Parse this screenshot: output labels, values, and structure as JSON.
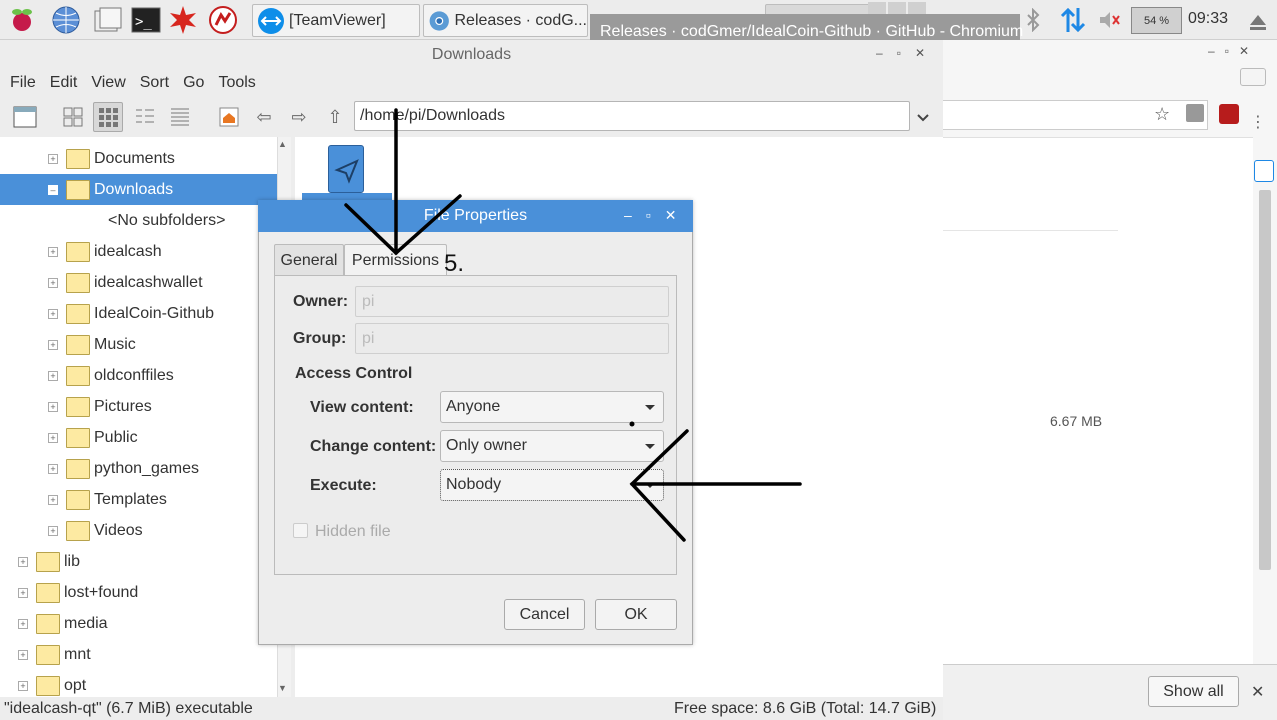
{
  "taskbar": {
    "tasks": [
      {
        "label": "[TeamViewer]"
      },
      {
        "label": "Releases · codG..."
      }
    ],
    "tooltip": "Releases · codGmer/IdealCoin-Github · GitHub - Chromium",
    "cpu": "54 %",
    "clock": "09:33"
  },
  "chromium": {
    "download_size": "6.67 MB",
    "show_all": "Show all"
  },
  "file_manager": {
    "title": "Downloads",
    "menu": [
      "File",
      "Edit",
      "View",
      "Sort",
      "Go",
      "Tools"
    ],
    "path": "/home/pi/Downloads",
    "tree": [
      {
        "label": "Documents",
        "indent": 1,
        "expander": "+"
      },
      {
        "label": "Downloads",
        "indent": 1,
        "expander": "-",
        "selected": true
      },
      {
        "label": "<No subfolders>",
        "indent": 2,
        "expander": ""
      },
      {
        "label": "idealcash",
        "indent": 1,
        "expander": "+"
      },
      {
        "label": "idealcashwallet",
        "indent": 1,
        "expander": "+"
      },
      {
        "label": "IdealCoin-Github",
        "indent": 1,
        "expander": "+"
      },
      {
        "label": "Music",
        "indent": 1,
        "expander": "+"
      },
      {
        "label": "oldconffiles",
        "indent": 1,
        "expander": "+"
      },
      {
        "label": "Pictures",
        "indent": 1,
        "expander": "+"
      },
      {
        "label": "Public",
        "indent": 1,
        "expander": "+"
      },
      {
        "label": "python_games",
        "indent": 1,
        "expander": "+"
      },
      {
        "label": "Templates",
        "indent": 1,
        "expander": "+"
      },
      {
        "label": "Videos",
        "indent": 1,
        "expander": "+"
      },
      {
        "label": "lib",
        "indent": 0,
        "expander": "+"
      },
      {
        "label": "lost+found",
        "indent": 0,
        "expander": "+"
      },
      {
        "label": "media",
        "indent": 0,
        "expander": "+"
      },
      {
        "label": "mnt",
        "indent": 0,
        "expander": "+"
      },
      {
        "label": "opt",
        "indent": 0,
        "expander": "+"
      }
    ],
    "status_left": "\"idealcash-qt\" (6.7 MiB) executable",
    "status_right": "Free space: 8.6 GiB (Total: 14.7 GiB)"
  },
  "dialog": {
    "title": "File Properties",
    "tabs": [
      "General",
      "Permissions"
    ],
    "annotation": "5.",
    "owner_label": "Owner:",
    "owner_value": "pi",
    "group_label": "Group:",
    "group_value": "pi",
    "access_heading": "Access Control",
    "view_label": "View content:",
    "view_value": "Anyone",
    "change_label": "Change content:",
    "change_value": "Only owner",
    "execute_label": "Execute:",
    "execute_value": "Nobody",
    "hidden_label": "Hidden file",
    "cancel": "Cancel",
    "ok": "OK"
  }
}
